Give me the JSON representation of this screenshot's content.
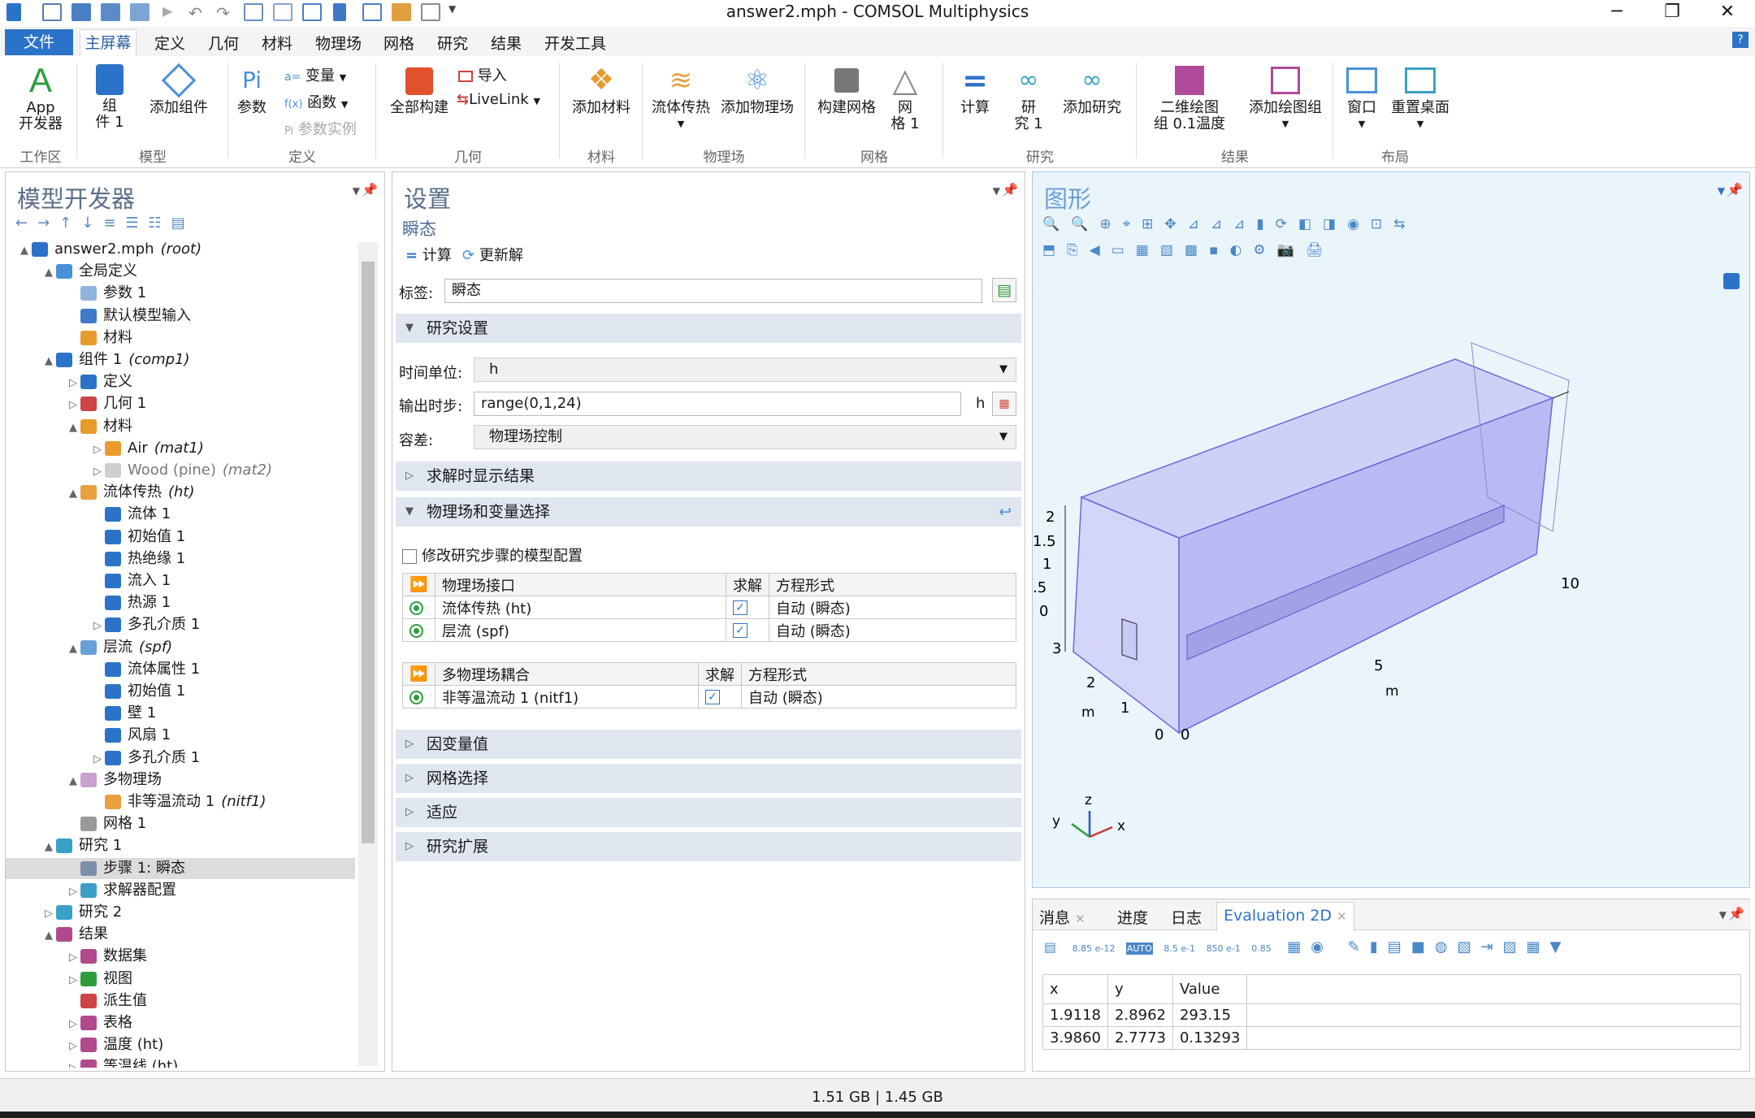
{
  "window": {
    "title": "answer2.mph - COMSOL Multiphysics"
  },
  "menu": {
    "tabs": [
      "文件",
      "主屏幕",
      "定义",
      "几何",
      "材料",
      "物理场",
      "网格",
      "研究",
      "结果",
      "开发工具"
    ]
  },
  "ribbon": {
    "app": {
      "line1": "App",
      "line2": "开发器"
    },
    "component": {
      "line1": "组",
      "line2": "件 1"
    },
    "add_component": "添加组件",
    "params": "参数",
    "variables": "变量",
    "functions": "函数",
    "param_instance": "参数实例",
    "build_all": "全部构建",
    "import": "导入",
    "livelink": "LiveLink",
    "add_material": "添加材料",
    "fluid_heat": "流体传热",
    "add_physics": "添加物理场",
    "build_mesh": "构建网格",
    "mesh": {
      "line1": "网",
      "line2": "格 1"
    },
    "compute": "计算",
    "study": {
      "line1": "研",
      "line2": "究 1"
    },
    "add_study": "添加研究",
    "plot_group": {
      "line1": "二维绘图",
      "line2": "组 0.1温度"
    },
    "add_plot_group": "添加绘图组",
    "window": "窗口",
    "reset_desktop": "重置桌面",
    "groups": [
      "工作区",
      "模型",
      "定义",
      "几何",
      "材料",
      "物理场",
      "网格",
      "研究",
      "结果",
      "布局"
    ],
    "help": "?"
  },
  "model_builder": {
    "title": "模型开发器",
    "tree": [
      {
        "label": "answer2.mph",
        "tag": "(root)",
        "level": 0,
        "toggle": "▲",
        "icon": "#2b73c9",
        "sel": false
      },
      {
        "label": "全局定义",
        "tag": "",
        "level": 1,
        "toggle": "▲",
        "icon": "#4a90d9",
        "sel": false
      },
      {
        "label": "参数 1",
        "tag": "",
        "level": 2,
        "toggle": "",
        "icon": "#8fb3de",
        "sel": false
      },
      {
        "label": "默认模型输入",
        "tag": "",
        "level": 2,
        "toggle": "",
        "icon": "#3d7ac8",
        "sel": false
      },
      {
        "label": "材料",
        "tag": "",
        "level": 2,
        "toggle": "",
        "icon": "#e89a2c",
        "sel": false
      },
      {
        "label": "组件 1",
        "tag": "(comp1)",
        "level": 1,
        "toggle": "▲",
        "icon": "#2b73c9",
        "sel": false
      },
      {
        "label": "定义",
        "tag": "",
        "level": 2,
        "toggle": "▷",
        "icon": "#2b73c9",
        "sel": false
      },
      {
        "label": "几何 1",
        "tag": "",
        "level": 2,
        "toggle": "▷",
        "icon": "#c44",
        "sel": false
      },
      {
        "label": "材料",
        "tag": "",
        "level": 2,
        "toggle": "▲",
        "icon": "#e89a2c",
        "sel": false
      },
      {
        "label": "Air",
        "tag": "(mat1)",
        "level": 3,
        "toggle": "▷",
        "icon": "#e89a2c",
        "sel": false
      },
      {
        "label": "Wood (pine)",
        "tag": "(mat2)",
        "level": 3,
        "toggle": "▷",
        "icon": "#cfcfcf",
        "sel": false,
        "dim": true
      },
      {
        "label": "流体传热",
        "tag": "(ht)",
        "level": 2,
        "toggle": "▲",
        "icon": "#e8a040",
        "sel": false
      },
      {
        "label": "流体 1",
        "tag": "",
        "level": 3,
        "toggle": "",
        "icon": "#2b73c9",
        "sel": false
      },
      {
        "label": "初始值 1",
        "tag": "",
        "level": 3,
        "toggle": "",
        "icon": "#2b73c9",
        "sel": false
      },
      {
        "label": "热绝缘 1",
        "tag": "",
        "level": 3,
        "toggle": "",
        "icon": "#2b73c9",
        "sel": false
      },
      {
        "label": "流入 1",
        "tag": "",
        "level": 3,
        "toggle": "",
        "icon": "#2b73c9",
        "sel": false
      },
      {
        "label": "热源 1",
        "tag": "",
        "level": 3,
        "toggle": "",
        "icon": "#2b73c9",
        "sel": false
      },
      {
        "label": "多孔介质 1",
        "tag": "",
        "level": 3,
        "toggle": "▷",
        "icon": "#2b73c9",
        "sel": false
      },
      {
        "label": "层流",
        "tag": "(spf)",
        "level": 2,
        "toggle": "▲",
        "icon": "#6aa0d8",
        "sel": false
      },
      {
        "label": "流体属性 1",
        "tag": "",
        "level": 3,
        "toggle": "",
        "icon": "#2b73c9",
        "sel": false
      },
      {
        "label": "初始值 1",
        "tag": "",
        "level": 3,
        "toggle": "",
        "icon": "#2b73c9",
        "sel": false
      },
      {
        "label": "壁 1",
        "tag": "",
        "level": 3,
        "toggle": "",
        "icon": "#2b73c9",
        "sel": false
      },
      {
        "label": "风扇 1",
        "tag": "",
        "level": 3,
        "toggle": "",
        "icon": "#2b73c9",
        "sel": false
      },
      {
        "label": "多孔介质 1",
        "tag": "",
        "level": 3,
        "toggle": "▷",
        "icon": "#2b73c9",
        "sel": false
      },
      {
        "label": "多物理场",
        "tag": "",
        "level": 2,
        "toggle": "▲",
        "icon": "#c8a0d0",
        "sel": false
      },
      {
        "label": "非等温流动 1",
        "tag": "(nitf1)",
        "level": 3,
        "toggle": "",
        "icon": "#e8a040",
        "sel": false
      },
      {
        "label": "网格 1",
        "tag": "",
        "level": 2,
        "toggle": "",
        "icon": "#999",
        "sel": false
      },
      {
        "label": "研究 1",
        "tag": "",
        "level": 1,
        "toggle": "▲",
        "icon": "#3aa0c8",
        "sel": false
      },
      {
        "label": "步骤 1: 瞬态",
        "tag": "",
        "level": 2,
        "toggle": "",
        "icon": "#7a8fa8",
        "sel": true
      },
      {
        "label": "求解器配置",
        "tag": "",
        "level": 2,
        "toggle": "▷",
        "icon": "#3aa0c8",
        "sel": false
      },
      {
        "label": "研究 2",
        "tag": "",
        "level": 1,
        "toggle": "▷",
        "icon": "#3aa0c8",
        "sel": false
      },
      {
        "label": "结果",
        "tag": "",
        "level": 1,
        "toggle": "▲",
        "icon": "#b04a8a",
        "sel": false
      },
      {
        "label": "数据集",
        "tag": "",
        "level": 2,
        "toggle": "▷",
        "icon": "#b04a8a",
        "sel": false
      },
      {
        "label": "视图",
        "tag": "",
        "level": 2,
        "toggle": "▷",
        "icon": "#2e9c3c",
        "sel": false
      },
      {
        "label": "派生值",
        "tag": "",
        "level": 2,
        "toggle": "",
        "icon": "#c44",
        "sel": false
      },
      {
        "label": "表格",
        "tag": "",
        "level": 2,
        "toggle": "▷",
        "icon": "#b04a8a",
        "sel": false
      },
      {
        "label": "温度 (ht)",
        "tag": "",
        "level": 2,
        "toggle": "▷",
        "icon": "#b04a8a",
        "sel": false
      },
      {
        "label": "等温线 (ht)",
        "tag": "",
        "level": 2,
        "toggle": "▷",
        "icon": "#b04a8a",
        "sel": false
      }
    ]
  },
  "settings": {
    "title": "设置",
    "subtitle": "瞬态",
    "compute": "计算",
    "update_solution": "更新解",
    "label_label": "标签:",
    "label_value": "瞬态",
    "section_study": "研究设置",
    "time_unit_label": "时间单位:",
    "time_unit_value": "h",
    "output_times_label": "输出时步:",
    "output_times_value": "range(0,1,24)",
    "output_times_unit": "h",
    "tolerance_label": "容差:",
    "tolerance_value": "物理场控制",
    "section_results": "求解时显示结果",
    "section_physics": "物理场和变量选择",
    "modify_config": "修改研究步骤的模型配置",
    "physics_table": {
      "headers": [
        "物理场接口",
        "求解",
        "方程形式"
      ],
      "rows": [
        [
          "流体传热 (ht)",
          "自动 (瞬态)"
        ],
        [
          "层流 (spf)",
          "自动 (瞬态)"
        ]
      ]
    },
    "multiphysics_table": {
      "headers": [
        "多物理场耦合",
        "求解",
        "方程形式"
      ],
      "rows": [
        [
          "非等温流动 1 (nitf1)",
          "自动 (瞬态)"
        ]
      ]
    },
    "section_dependent": "因变量值",
    "section_mesh": "网格选择",
    "section_adapt": "适应",
    "section_extension": "研究扩展"
  },
  "graphics": {
    "title": "图形",
    "axis_ticks": {
      "z": [
        "2",
        "1.5",
        "1",
        ".5",
        "0"
      ],
      "x": [
        "5",
        "10"
      ],
      "y": [
        "3",
        "2",
        "1",
        "0"
      ],
      "origin": "0"
    },
    "unit": "m",
    "triad": {
      "x": "x",
      "y": "y",
      "z": "z"
    }
  },
  "bottom": {
    "tabs": [
      "消息",
      "进度",
      "日志",
      "Evaluation 2D"
    ],
    "toolbar_labels": [
      "8.85 e-12",
      "AUTO",
      "8.5 e-1",
      "850 e-1",
      "0.85"
    ],
    "table": {
      "headers": [
        "x",
        "y",
        "Value"
      ],
      "rows": [
        [
          "1.9118",
          "2.8962",
          "293.15"
        ],
        [
          "3.9860",
          "2.7773",
          "0.13293"
        ]
      ]
    }
  },
  "status": {
    "memory": "1.51 GB | 1.45 GB"
  }
}
